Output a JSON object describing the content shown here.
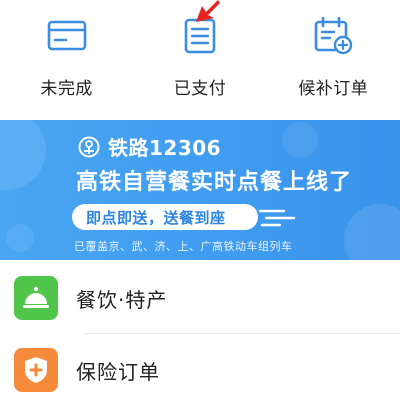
{
  "top_row": {
    "items": [
      {
        "label": "未完成",
        "icon": "card-icon"
      },
      {
        "label": "已支付",
        "icon": "receipt-icon"
      },
      {
        "label": "候补订单",
        "icon": "calendar-add-icon"
      }
    ]
  },
  "banner": {
    "brand": "铁路12306",
    "headline": "高铁自营餐实时点餐上线了",
    "pill": "即点即送，送餐到座",
    "footnote": "已覆盖京、武、济、上、广高铁动车组列车"
  },
  "list": {
    "items": [
      {
        "label": "餐饮·特产",
        "icon": "service-bell-icon"
      },
      {
        "label": "保险订单",
        "icon": "shield-plus-icon"
      }
    ]
  },
  "colors": {
    "accent_blue": "#3f9cf0",
    "icon_blue": "#3b8de0",
    "arrow_red": "#e8231f",
    "green": "#4fc64a",
    "orange": "#f48a3a"
  }
}
